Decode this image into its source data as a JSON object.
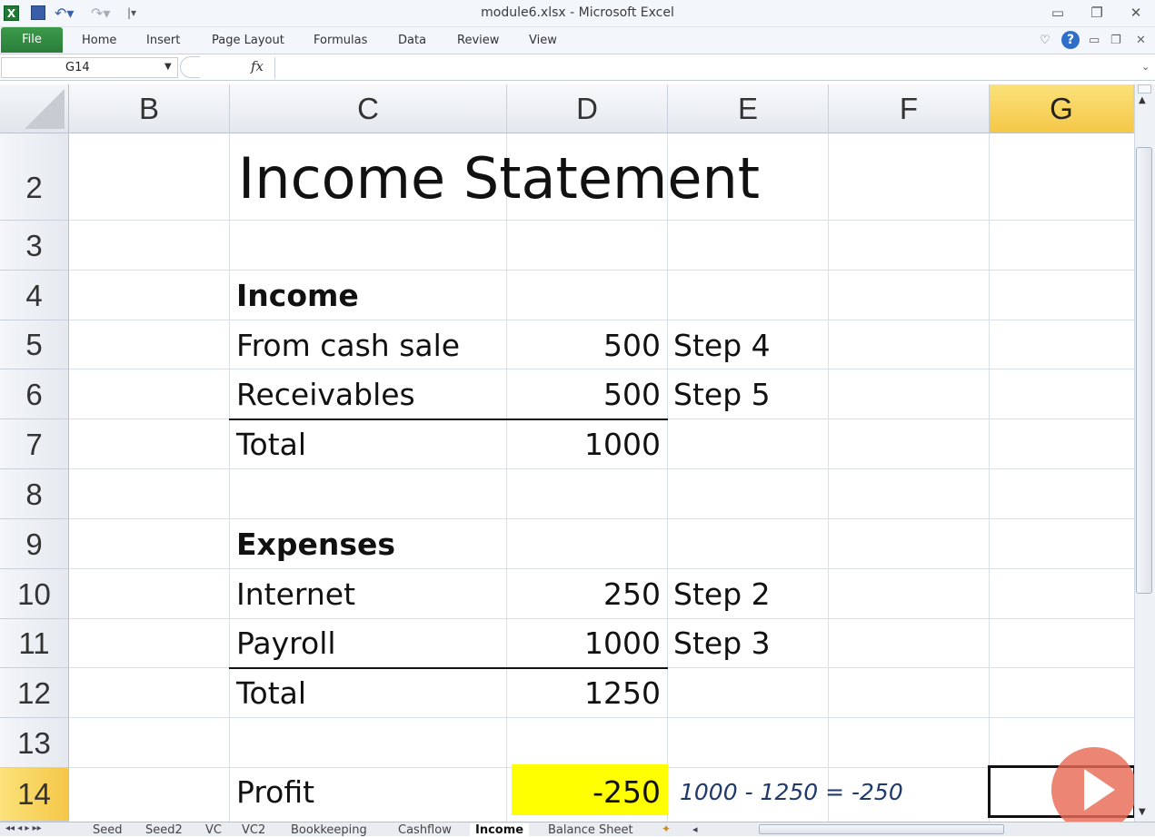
{
  "window": {
    "title": "module6.xlsx - Microsoft Excel"
  },
  "ribbon": {
    "file_label": "File",
    "tabs": [
      "Home",
      "Insert",
      "Page Layout",
      "Formulas",
      "Data",
      "Review",
      "View"
    ]
  },
  "formula_bar": {
    "name_box": "G14",
    "fx_label": "fx",
    "formula": ""
  },
  "columns": [
    "B",
    "C",
    "D",
    "E",
    "F",
    "G"
  ],
  "selected_column": "G",
  "rows": [
    "2",
    "3",
    "4",
    "5",
    "6",
    "7",
    "8",
    "9",
    "10",
    "11",
    "12",
    "13",
    "14"
  ],
  "selected_row": "14",
  "sheet": {
    "title": "Income Statement",
    "income_header": "Income",
    "cash_sale_label": "From cash sale",
    "cash_sale_value": "500",
    "cash_sale_note": "Step 4",
    "receivables_label": "Receivables",
    "receivables_value": "500",
    "receivables_note": "Step 5",
    "income_total_label": "Total",
    "income_total_value": "1000",
    "expenses_header": "Expenses",
    "internet_label": "Internet",
    "internet_value": "250",
    "internet_note": "Step 2",
    "payroll_label": "Payroll",
    "payroll_value": "1000",
    "payroll_note": "Step 3",
    "expenses_total_label": "Total",
    "expenses_total_value": "1250",
    "profit_label": "Profit",
    "profit_value": "-250",
    "profit_note": "1000 - 1250 = -250"
  },
  "sheet_tabs": [
    "Seed",
    "Seed2",
    "VC",
    "VC2",
    "Bookkeeping",
    "Cashflow",
    "Income",
    "Balance Sheet"
  ],
  "active_sheet": "Income",
  "colors": {
    "highlight": "#ffff00",
    "file_tab": "#2e8b3e",
    "selected_header": "#f5c748",
    "note": "#1f3a6b"
  }
}
